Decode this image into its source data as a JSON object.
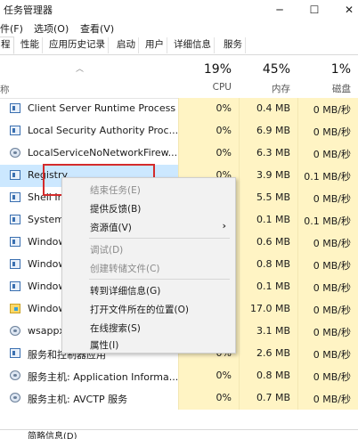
{
  "window": {
    "title": "任务管理器",
    "min_glyph": "─",
    "max_glyph": "☐",
    "close_glyph": "✕"
  },
  "menubar": {
    "file": "件(F)",
    "options": "选项(O)",
    "view": "查看(V)"
  },
  "tabs": [
    "程",
    "性能",
    "应用历史记录",
    "启动",
    "用户",
    "详细信息",
    "服务"
  ],
  "header": {
    "name_label": "称",
    "cpu": {
      "pct": "19%",
      "label": "CPU"
    },
    "memory": {
      "pct": "45%",
      "label": "内存"
    },
    "disk": {
      "pct": "1%",
      "label": "磁盘"
    }
  },
  "rows": [
    {
      "name": "Client Server Runtime Process",
      "cpu": "0%",
      "mem": "0.4 MB",
      "disk": "0 MB/秒",
      "icon": "process-window-icon"
    },
    {
      "name": "Local Security Authority Proc...",
      "cpu": "0%",
      "mem": "6.9 MB",
      "disk": "0 MB/秒",
      "icon": "process-window-icon"
    },
    {
      "name": "LocalServiceNoNetworkFirew...",
      "cpu": "0%",
      "mem": "6.3 MB",
      "disk": "0 MB/秒",
      "icon": "service-gear-icon"
    },
    {
      "name": "Registry",
      "cpu": "0%",
      "mem": "3.9 MB",
      "disk": "0.1 MB/秒",
      "icon": "process-window-icon"
    },
    {
      "name": "Shell In",
      "cpu": "0%",
      "mem": "5.5 MB",
      "disk": "0 MB/秒",
      "icon": "process-window-icon"
    },
    {
      "name": "System",
      "cpu": "0%",
      "mem": "0.1 MB",
      "disk": "0.1 MB/秒",
      "icon": "process-window-icon"
    },
    {
      "name": "Window",
      "cpu": "0%",
      "mem": "0.6 MB",
      "disk": "0 MB/秒",
      "icon": "process-window-icon"
    },
    {
      "name": "Window",
      "cpu": "0%",
      "mem": "0.8 MB",
      "disk": "0 MB/秒",
      "icon": "process-window-icon"
    },
    {
      "name": "Window",
      "cpu": "0%",
      "mem": "0.1 MB",
      "disk": "0 MB/秒",
      "icon": "process-window-icon"
    },
    {
      "name": "Window",
      "cpu": "0%",
      "mem": "17.0 MB",
      "disk": "0 MB/秒",
      "icon": "explorer-folder-icon"
    },
    {
      "name": "wsappx",
      "cpu": "0%",
      "mem": "3.1 MB",
      "disk": "0 MB/秒",
      "icon": "service-gear-icon"
    },
    {
      "name": "服务和控制器应用",
      "cpu": "0%",
      "mem": "2.6 MB",
      "disk": "0 MB/秒",
      "icon": "process-window-icon"
    },
    {
      "name": "服务主机: Application Informa...",
      "cpu": "0%",
      "mem": "0.8 MB",
      "disk": "0 MB/秒",
      "icon": "service-gear-icon"
    },
    {
      "name": "服务主机: AVCTP 服务",
      "cpu": "0%",
      "mem": "0.7 MB",
      "disk": "0 MB/秒",
      "icon": "service-gear-icon"
    }
  ],
  "context_menu": {
    "end_task": "结束任务(E)",
    "feedback": "提供反馈(B)",
    "resource_values": "资源值(V)",
    "debug": "调试(D)",
    "create_dump": "创建转储文件(C)",
    "go_details": "转到详细信息(G)",
    "open_location": "打开文件所在的位置(O)",
    "search_online": "在线搜索(S)",
    "properties": "属性(I)",
    "submenu_arrow": "›"
  },
  "footer": {
    "fewer_details": "简略信息(D)"
  }
}
